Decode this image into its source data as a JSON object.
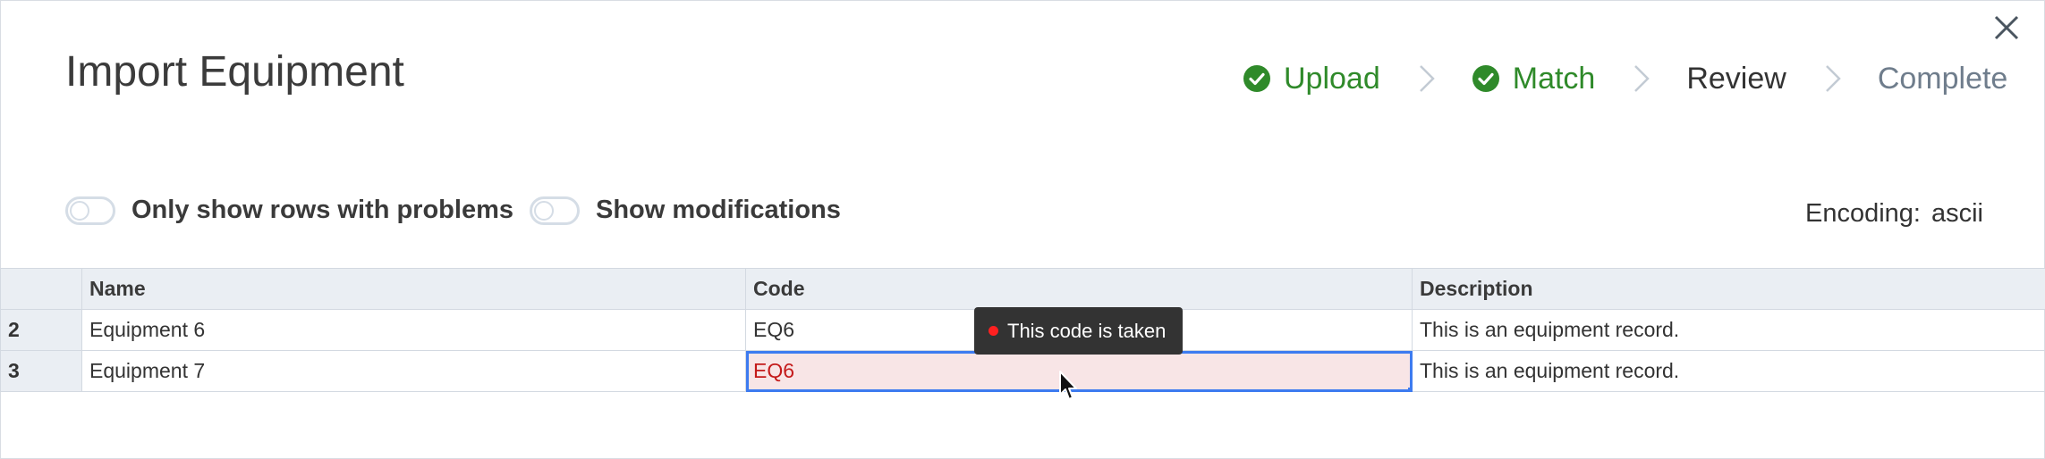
{
  "dialog": {
    "title": "Import Equipment",
    "close_icon": "close-icon"
  },
  "steps": [
    {
      "label": "Upload",
      "state": "done"
    },
    {
      "label": "Match",
      "state": "done"
    },
    {
      "label": "Review",
      "state": "current"
    },
    {
      "label": "Complete",
      "state": "pending"
    }
  ],
  "toggles": {
    "problems_label": "Only show rows with problems",
    "problems_on": false,
    "modifications_label": "Show modifications",
    "modifications_on": false
  },
  "encoding": {
    "label": "Encoding:",
    "value": "ascii"
  },
  "table": {
    "columns": [
      "",
      "Name",
      "Code",
      "Description"
    ],
    "rows": [
      {
        "num": "2",
        "name": "Equipment 6",
        "code": "EQ6",
        "description": "This is an equipment record."
      },
      {
        "num": "3",
        "name": "Equipment 7",
        "code": "EQ6",
        "description": "This is an equipment record."
      }
    ]
  },
  "tooltip": {
    "text": "This code is taken"
  },
  "colors": {
    "done": "#2f8a2a",
    "pending": "#6f7d8c",
    "error_bg": "#f8e5e6",
    "error_text": "#c41a1a",
    "selection": "#3d7bf0"
  }
}
